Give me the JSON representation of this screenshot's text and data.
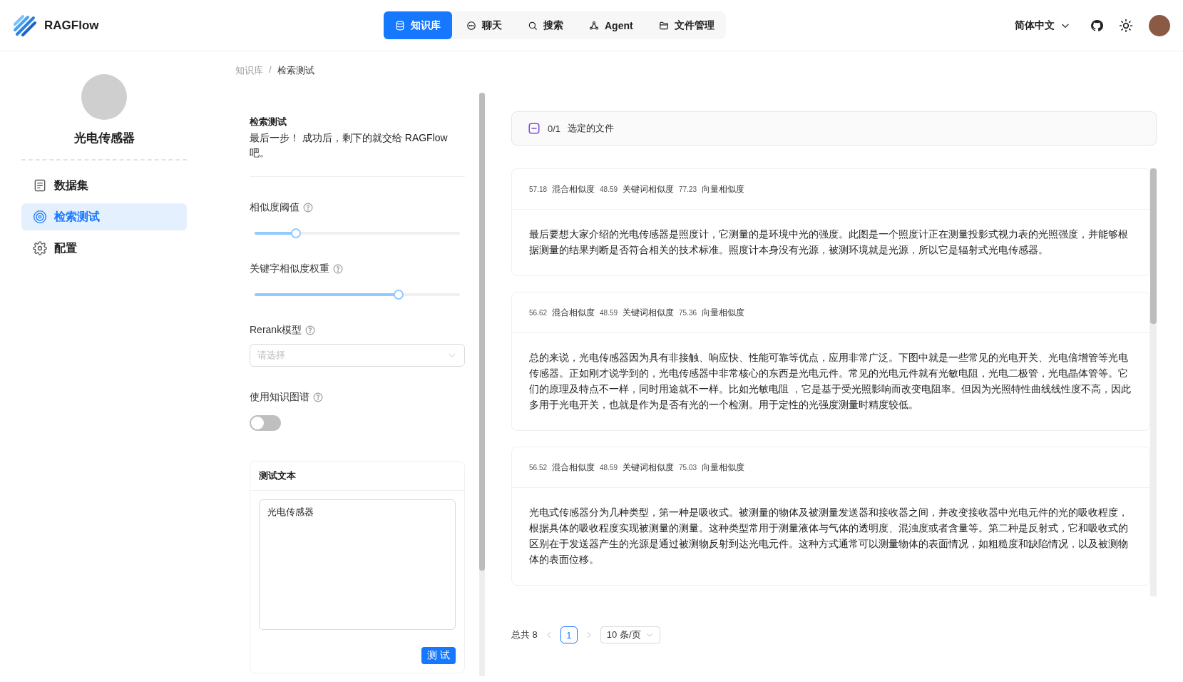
{
  "header": {
    "logo_text": "RAGFlow",
    "nav": [
      {
        "label": "知识库",
        "selected": true
      },
      {
        "label": "聊天",
        "selected": false
      },
      {
        "label": "搜索",
        "selected": false
      },
      {
        "label": "Agent",
        "selected": false
      },
      {
        "label": "文件管理",
        "selected": false
      }
    ],
    "language": "简体中文"
  },
  "sidebar": {
    "title": "光电传感器",
    "items": [
      {
        "label": "数据集",
        "selected": false
      },
      {
        "label": "检索测试",
        "selected": true
      },
      {
        "label": "配置",
        "selected": false
      }
    ]
  },
  "breadcrumb": {
    "items": [
      "知识库",
      "检索测试"
    ],
    "separator": "/"
  },
  "settings": {
    "title": "检索测试",
    "description": "最后一步！ 成功后，剩下的就交给 RAGFlow 吧。",
    "similarity_threshold": {
      "label": "相似度阈值",
      "level": 0.2
    },
    "keyword_weight": {
      "label": "关键字相似度权重",
      "level": 0.7
    },
    "rerank": {
      "label": "Rerank模型",
      "placeholder": "请选择"
    },
    "knowledge_graph": {
      "label": "使用知识图谱",
      "on": false
    },
    "test_text": {
      "title": "测试文本",
      "value": "光电传感器",
      "button": "测 试"
    }
  },
  "results": {
    "selection_count": "0/1",
    "selection_label": "选定的文件",
    "chunks": [
      {
        "hybrid": "57.18",
        "hybrid_label": "混合相似度",
        "keyword": "48.59",
        "keyword_label": "关键词相似度",
        "vector": "77.23",
        "vector_label": "向量相似度",
        "text": "最后要想大家介绍的光电传感器是照度计，它测量的是环境中光的强度。此图是一个照度计正在测量投影式视力表的光照强度，并能够根据测量的结果判断是否符合相关的技术标准。照度计本身没有光源，被测环境就是光源，所以它是辐射式光电传感器。"
      },
      {
        "hybrid": "56.62",
        "hybrid_label": "混合相似度",
        "keyword": "48.59",
        "keyword_label": "关键词相似度",
        "vector": "75.36",
        "vector_label": "向量相似度",
        "text": "总的来说，光电传感器因为具有非接触、响应快、性能可靠等优点，应用非常广泛。下图中就是一些常见的光电开关、光电倍增管等光电传感器。正如刚才说学到的，光电传感器中非常核心的东西是光电元件。常见的光电元件就有光敏电阻，光电二极管，光电晶体管等。它们的原理及特点不一样，同时用途就不一样。比如光敏电阻 ，它是基于受光照影响而改变电阻率。但因为光照特性曲线线性度不高，因此多用于光电开关，也就是作为是否有光的一个检测。用于定性的光强度测量时精度较低。"
      },
      {
        "hybrid": "56.52",
        "hybrid_label": "混合相似度",
        "keyword": "48.59",
        "keyword_label": "关键词相似度",
        "vector": "75.03",
        "vector_label": "向量相似度",
        "text": "光电式传感器分为几种类型，第一种是吸收式。被测量的物体及被测量发送器和接收器之间，并改变接收器中光电元件的光的吸收程度，根据具体的吸收程度实现被测量的测量。这种类型常用于测量液体与气体的透明度、混浊度或者含量等。第二种是反射式，它和吸收式的区别在于发送器产生的光源是通过被测物反射到达光电元件。这种方式通常可以测量物体的表面情况，如粗糙度和缺陷情况，以及被测物体的表面位移。"
      }
    ],
    "pagination": {
      "total": "总共 8",
      "pages": [
        {
          "label": "1",
          "selected": true
        }
      ],
      "page_size": "10 条/页"
    }
  }
}
